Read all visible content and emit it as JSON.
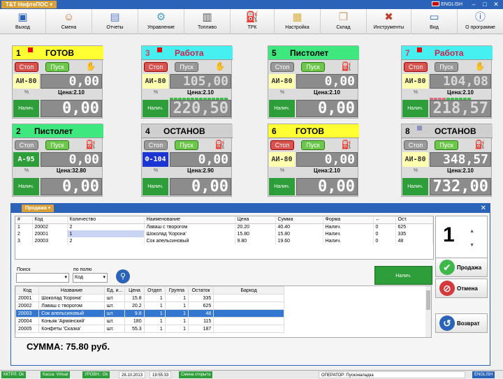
{
  "titlebar": {
    "app": "Т&Т НефтеПОС",
    "lang": "ENGLISH"
  },
  "toolbar": [
    "Выход",
    "Смена",
    "Отчеты",
    "Управление",
    "Топливо",
    "ТРК",
    "Настройка",
    "Склад",
    "Инструменты",
    "Вид",
    "О программе"
  ],
  "pumps": [
    {
      "num": "1",
      "state": "ГОТОВ",
      "fuel": "АИ-80",
      "volume": "0,00",
      "price": "Цена:2.10",
      "pay": "Налич.",
      "sum": "0,00",
      "stop": "Стоп",
      "go": "Пуск"
    },
    {
      "num": "3",
      "state": "Работа",
      "fuel": "АИ-80",
      "volume": "105,00",
      "price": "Цена:2.10",
      "pay": "Налич.",
      "sum": "220,50",
      "stop": "Стоп",
      "go": "Пуск"
    },
    {
      "num": "5",
      "state": "Пистолет",
      "fuel": "АИ-80",
      "volume": "0,00",
      "price": "Цена:2.10",
      "pay": "Налич.",
      "sum": "0,00",
      "stop": "Стоп",
      "go": "Пуск"
    },
    {
      "num": "7",
      "state": "Работа",
      "fuel": "АИ-80",
      "volume": "104,08",
      "price": "Цена:2.10",
      "pay": "Налич.",
      "sum": "218,57",
      "stop": "Стоп",
      "go": "Пуск"
    },
    {
      "num": "2",
      "state": "Пистолет",
      "fuel": "А-95",
      "volume": "0,00",
      "price": "Цена:32.80",
      "pay": "Налич.",
      "sum": "0,00",
      "stop": "Стоп",
      "go": "Пуск"
    },
    {
      "num": "4",
      "state": "ОСТАНОВ",
      "fuel": "Ф-104",
      "volume": "0,00",
      "price": "Цена:2.90",
      "pay": "Налич.",
      "sum": "0,00",
      "stop": "Стоп",
      "go": "Пуск"
    },
    {
      "num": "6",
      "state": "ГОТОВ",
      "fuel": "АИ-80",
      "volume": "0,00",
      "price": "Цена:2.10",
      "pay": "Налич.",
      "sum": "0,00",
      "stop": "Стоп",
      "go": "Пуск"
    },
    {
      "num": "8",
      "state": "ОСТАНОВ",
      "fuel": "АИ-80",
      "volume": "348,57",
      "price": "Цена:2.10",
      "pay": "Налич.",
      "sum": "732,00",
      "stop": "Стоп",
      "go": "Пуск"
    }
  ],
  "sale": {
    "title": "Продажа",
    "headers": [
      "#",
      "Код",
      "Количество",
      "Наименование",
      "Цена",
      "Сумма",
      "Форма",
      "←",
      "Ост."
    ],
    "rows": [
      [
        "1",
        "20002",
        "2",
        "Лаваш с творогом",
        "20.20",
        "40.40",
        "Налич.",
        "0",
        "625"
      ],
      [
        "2",
        "20001",
        "1",
        "Шоколад 'Корона'",
        "15.80",
        "15.80",
        "Налич.",
        "0",
        "335"
      ],
      [
        "3",
        "20003",
        "2",
        "Сок апельсиновый",
        "9.80",
        "19.60",
        "Налич.",
        "0",
        "48"
      ]
    ],
    "qty": "1",
    "search_label": "Поиск",
    "field_label": "по полю",
    "field_value": "Код",
    "pay_button": "Налич.",
    "catalog_headers": [
      "Код",
      "Название",
      "Ед. и...",
      "Цена",
      "Отдел",
      "Группа",
      "Остаток",
      "Баркод"
    ],
    "catalog": [
      [
        "20001",
        "Шоколад 'Корона'",
        "шт.",
        "15.8",
        "1",
        "1",
        "335",
        ""
      ],
      [
        "20002",
        "Лаваш с творогом",
        "шт.",
        "20.2",
        "1",
        "1",
        "625",
        ""
      ],
      [
        "20003",
        "Сок апельсиновый",
        "шт.",
        "9.8",
        "1",
        "1",
        "48",
        ""
      ],
      [
        "20004",
        "Коньяк 'Армянский'",
        "шт.",
        "180",
        "1",
        "1",
        "115",
        ""
      ],
      [
        "20005",
        "Конфеты 'Сказка'",
        "шт.",
        "55.3",
        "1",
        "1",
        "187",
        ""
      ]
    ],
    "total": "СУММА: 75.80 руб.",
    "btn_sale": "Продажа",
    "btn_cancel": "Отмена",
    "btn_return": "Возврат"
  },
  "status": [
    "ККТРЛ: Ok",
    "Касса: Virtual",
    "УРОВН.: Ok",
    "28.10.2013",
    "19:55:33",
    "Смена открыта",
    "ОПЕРАТОР: Пусконаладка",
    "ENGLISH"
  ]
}
